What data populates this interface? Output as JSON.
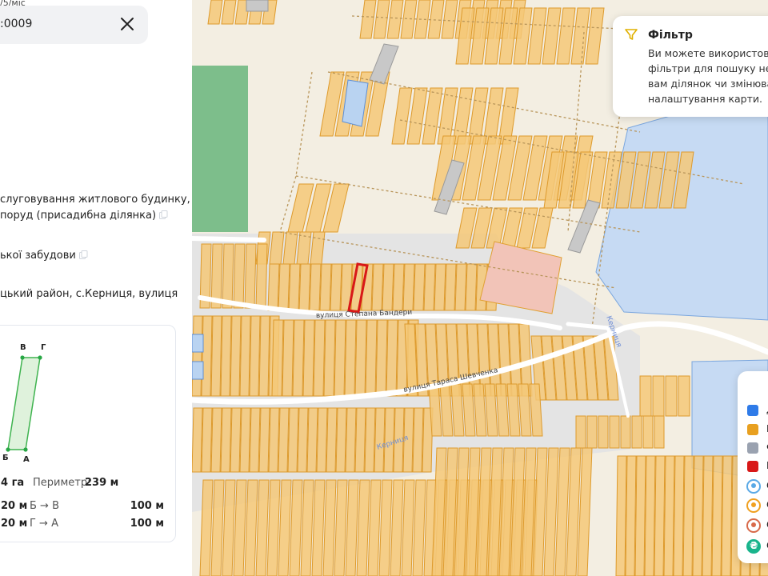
{
  "panel": {
    "top_text": "/5/міс",
    "search_value": ":0009",
    "purpose_line1": "слуговування житлового будинку,",
    "purpose_line2": "поруд (присадибна ділянка)",
    "category": "ької забудови",
    "address": "цький район, с.Керниця, вулиця",
    "plot": {
      "corner_b": "Б",
      "corner_a": "А",
      "corner_v": "В",
      "corner_g": "Г",
      "area_value": "4 га",
      "perimeter_label": "Периметр:",
      "perimeter_value": "239 м",
      "sides": [
        {
          "left_value": "20 м",
          "segment": "Б → В",
          "length": "100 м"
        },
        {
          "left_value": "20 м",
          "segment": "Г → А",
          "length": "100 м"
        }
      ]
    }
  },
  "map": {
    "streets": {
      "bandera": "вулиця Степана Бандери",
      "shevchenka": "вулиця Тараса Шевченка",
      "kernytsia_stream": "Керниця",
      "kernytsia_road": "Керниця"
    },
    "colors": {
      "parcel_fill": "#f5c878",
      "parcel_stroke": "#e0a032",
      "selected": "#d81818",
      "water": "#c5d9f2",
      "forest": "#7bbf8a",
      "settlement": "#e2e2e2"
    }
  },
  "filter": {
    "title": "Фільтр",
    "lines": [
      "Ви можете використовува",
      "фільтри для пошуку необх",
      "вам ділянок чи змінювати",
      "налаштування карти."
    ]
  },
  "legend": {
    "items": [
      {
        "letter": "Д",
        "color": "#2f7be8",
        "kind": "swatch"
      },
      {
        "letter": "Г",
        "color": "#e8a020",
        "kind": "swatch"
      },
      {
        "letter": "Ф",
        "color": "#9aa2b0",
        "kind": "swatch"
      },
      {
        "letter": "В",
        "color": "#d81818",
        "kind": "swatch"
      },
      {
        "letter": "С",
        "color": "#5aa9e6",
        "kind": "icon"
      },
      {
        "letter": "С",
        "color": "#f0a020",
        "kind": "icon"
      },
      {
        "letter": "С",
        "color": "#d86a4a",
        "kind": "icon"
      },
      {
        "letter": "С",
        "color": "#19b48c",
        "kind": "icon-money"
      }
    ]
  }
}
